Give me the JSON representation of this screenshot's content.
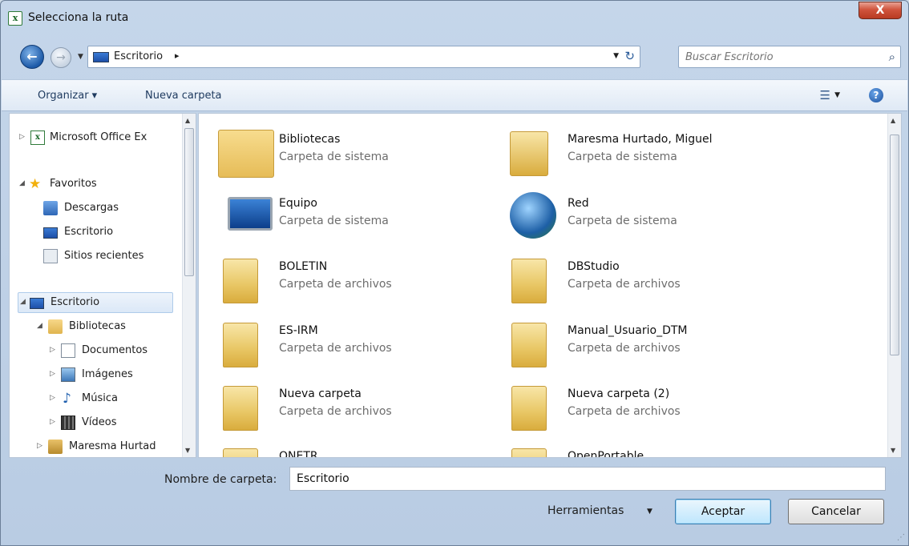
{
  "window": {
    "title": "Selecciona la ruta",
    "close_label": "X",
    "app_icon_label": "x"
  },
  "address": {
    "crumb": "Escritorio",
    "separator": "▸",
    "back_glyph": "←",
    "forward_glyph": "→",
    "dropdown_glyph": "▼",
    "refresh_glyph": "↻",
    "search_placeholder": "Buscar Escritorio",
    "search_glyph": "⌕"
  },
  "commandbar": {
    "organize": "Organizar ▾",
    "new_folder": "Nueva carpeta",
    "view_glyph": "☰",
    "view_arrow": "▼",
    "help_glyph": "?"
  },
  "nav": {
    "items": [
      {
        "label": "Microsoft Office Ex",
        "tri": "▷"
      },
      {
        "label": "Favoritos",
        "tri": "◢"
      },
      {
        "label": "Descargas",
        "tri": ""
      },
      {
        "label": "Escritorio",
        "tri": ""
      },
      {
        "label": "Sitios recientes",
        "tri": ""
      },
      {
        "label": "Escritorio",
        "tri": "◢"
      },
      {
        "label": "Bibliotecas",
        "tri": "◢"
      },
      {
        "label": "Documentos",
        "tri": "▷"
      },
      {
        "label": "Imágenes",
        "tri": "▷"
      },
      {
        "label": "Música",
        "tri": "▷"
      },
      {
        "label": "Vídeos",
        "tri": "▷"
      },
      {
        "label": "Maresma Hurtad",
        "tri": "▷"
      }
    ],
    "star_glyph": "★",
    "music_glyph": "♪",
    "excel_glyph": "x"
  },
  "main": {
    "tiles": [
      {
        "name": "Bibliotecas",
        "type": "Carpeta de sistema"
      },
      {
        "name": "Maresma Hurtado, Miguel",
        "type": "Carpeta de sistema"
      },
      {
        "name": "Equipo",
        "type": "Carpeta de sistema"
      },
      {
        "name": "Red",
        "type": "Carpeta de sistema"
      },
      {
        "name": "BOLETIN",
        "type": "Carpeta de archivos"
      },
      {
        "name": "DBStudio",
        "type": "Carpeta de archivos"
      },
      {
        "name": "ES-IRM",
        "type": "Carpeta de archivos"
      },
      {
        "name": "Manual_Usuario_DTM",
        "type": "Carpeta de archivos"
      },
      {
        "name": "Nueva carpeta",
        "type": "Carpeta de archivos"
      },
      {
        "name": "Nueva carpeta (2)",
        "type": "Carpeta de archivos"
      },
      {
        "name": "ONETR",
        "type": ""
      },
      {
        "name": "OpenPortable",
        "type": ""
      }
    ]
  },
  "footer": {
    "folder_label": "Nombre de carpeta:",
    "folder_value": "Escritorio",
    "tools": "Herramientas",
    "tools_arrow": "▼",
    "accept": "Aceptar",
    "cancel": "Cancelar",
    "grip": "⋰"
  },
  "scroll": {
    "up": "▲",
    "down": "▼",
    "grip": "≡"
  }
}
